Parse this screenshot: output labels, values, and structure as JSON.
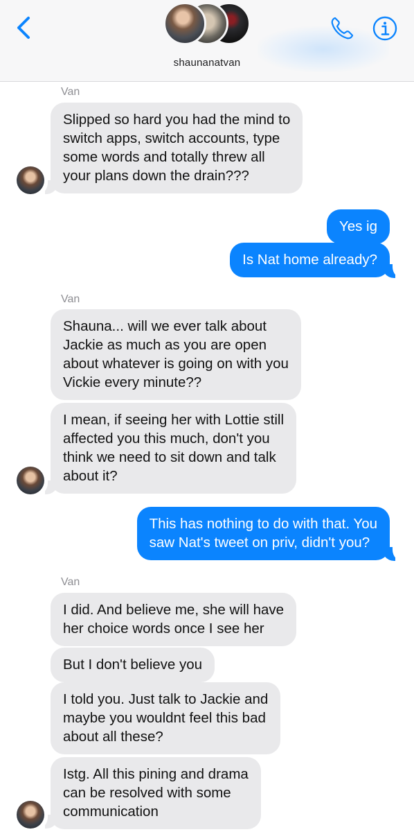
{
  "header": {
    "contact_name": "shaunanatvan",
    "back_icon": "chevron-left-icon",
    "call_icon": "phone-icon",
    "info_icon": "info-icon",
    "accent_color": "#0b84fe"
  },
  "thread": {
    "group1": {
      "sender": "Van",
      "messages": [
        "Slipped so hard you had the mind to\nswitch apps, switch accounts, type\nsome words and totally threw all\nyour plans down the drain???"
      ]
    },
    "outgoing1": [
      "Yes ig",
      "Is Nat home already?"
    ],
    "group2": {
      "sender": "Van",
      "messages": [
        "Shauna... will we ever talk about\nJackie as much as you are open\nabout whatever is going on with you\nVickie every minute??",
        "I mean, if seeing her with Lottie still\naffected you this much, don't you\nthink we need to sit down and talk\nabout it?"
      ]
    },
    "outgoing2": [
      "This has nothing to do with that. You\nsaw Nat's tweet on priv, didn't you?"
    ],
    "group3": {
      "sender": "Van",
      "messages": [
        "I did. And believe me, she will have\nher choice words once I see her",
        "But I don't believe you",
        "I told you. Just talk to Jackie and\nmaybe you wouldnt feel this bad\nabout all these?",
        "Istg. All this pining and drama\ncan be resolved with some\ncommunication"
      ]
    }
  },
  "colors": {
    "incoming_bubble": "#e9e9eb",
    "outgoing_bubble": "#0b84fe",
    "sender_label": "#8e8e93"
  }
}
